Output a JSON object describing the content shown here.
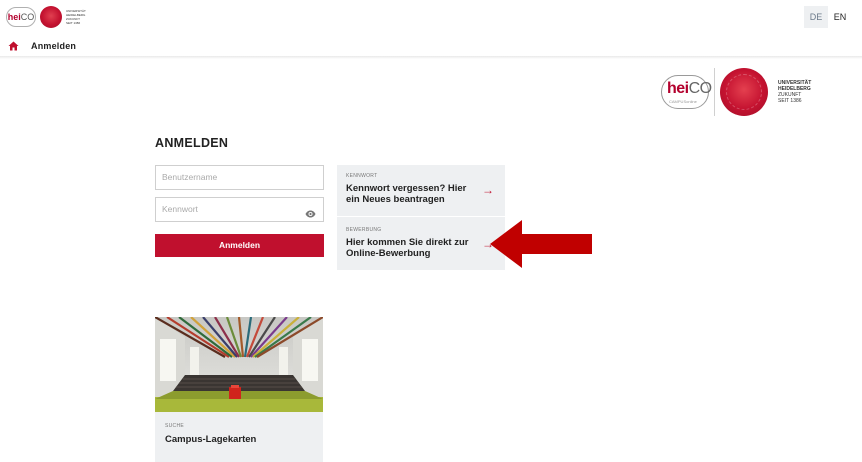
{
  "header": {
    "logo_heico": "heiCO",
    "logo_university_lines": [
      "UNIVERSITÄT",
      "HEIDELBERG",
      "ZUKUNFT",
      "SEIT 1386"
    ],
    "languages": [
      {
        "code": "DE",
        "active": true
      },
      {
        "code": "EN",
        "active": false
      }
    ]
  },
  "breadcrumb": {
    "icon": "home-icon",
    "label": "Anmelden"
  },
  "branding": {
    "heico_text": "heiCO",
    "heico_sub": "CAMPUSonline",
    "university_lines": [
      "UNIVERSITÄT",
      "HEIDELBERG",
      "ZUKUNFT",
      "SEIT 1386"
    ]
  },
  "login": {
    "heading": "ANMELDEN",
    "username_placeholder": "Benutzername",
    "password_placeholder": "Kennwort",
    "submit_label": "Anmelden",
    "password_toggle_icon": "eye-icon"
  },
  "tiles": {
    "kennwort": {
      "caption": "KENNWORT",
      "title": "Kennwort vergessen? Hier ein Neues beantragen",
      "icon": "arrow-right-icon"
    },
    "bewerbung": {
      "caption": "BEWERBUNG",
      "title": "Hier kommen Sie direkt zur Online-Bewerbung",
      "icon": "arrow-right-icon"
    }
  },
  "card": {
    "caption": "SUCHE",
    "title": "Campus-Lagekarten",
    "image": "lecture-hall-photo"
  },
  "colors": {
    "accent": "#c0102e",
    "tile_bg": "#eef0f2",
    "annotation_arrow": "#c00000"
  }
}
